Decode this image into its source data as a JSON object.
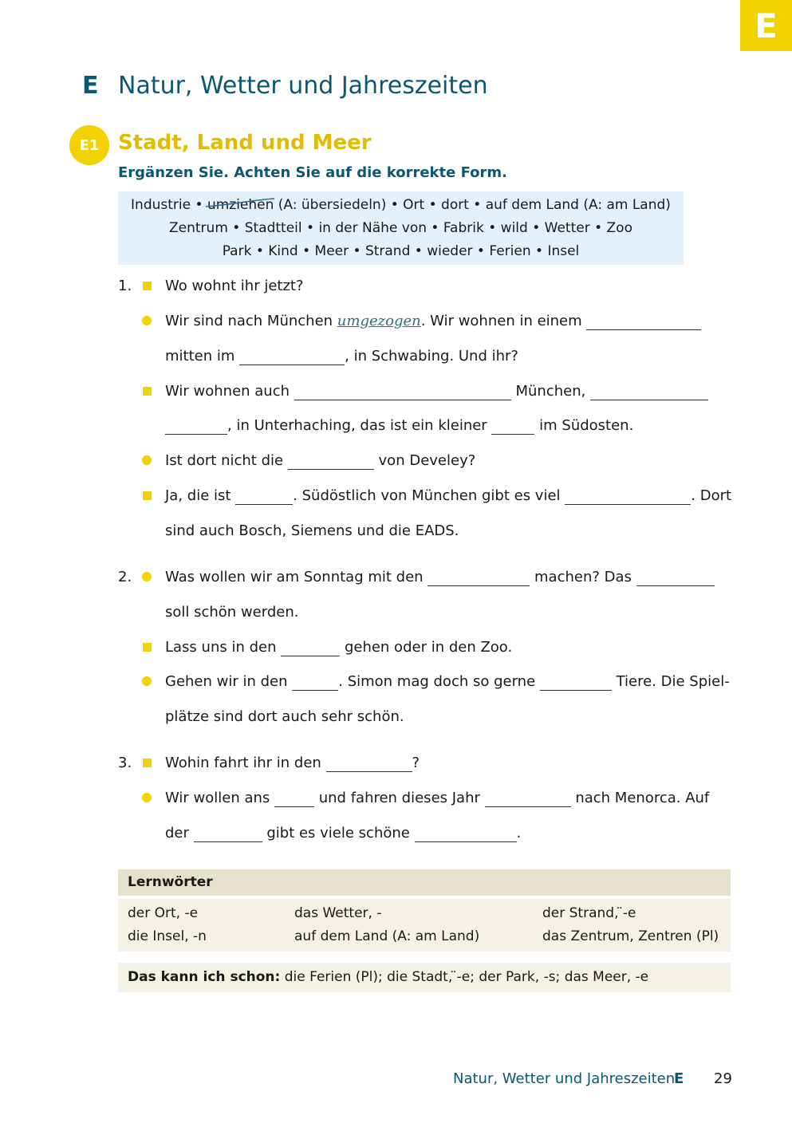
{
  "tab_letter": "E",
  "chapter": {
    "letter": "E",
    "title": "Natur, Wetter und Jahreszeiten"
  },
  "exercise": {
    "badge": "E1",
    "title": "Stadt, Land und Meer",
    "instruction": "Ergänzen Sie. Achten Sie auf die korrekte Form."
  },
  "wordbox": {
    "line1_before": "Industrie • ",
    "line1_struck": "umziehen",
    "line1_after": " (A: übersiedeln) • Ort • dort • auf dem Land (A: am Land)",
    "line2": "Zentrum • Stadtteil • in der Nähe von • Fabrik • wild • Wetter • Zoo",
    "line3": "Park • Kind • Meer • Strand • wieder • Ferien • Insel"
  },
  "dialogue": {
    "n1": "1.",
    "n2": "2.",
    "n3": "3.",
    "l01": "Wo wohnt ihr jetzt?",
    "l02a": "Wir sind nach München ",
    "l02_answer": "umgezogen",
    "l02b": ". Wir wohnen in einem ",
    "l03a": "mitten im ",
    "l03b": ", in Schwabing. Und ihr?",
    "l04a": "Wir wohnen auch ",
    "l04b": " München, ",
    "l05a": ", in Unterhaching, das ist ein kleiner ",
    "l05b": " im Südosten.",
    "l06a": "Ist dort nicht die ",
    "l06b": " von Develey?",
    "l07a": "Ja, die ist ",
    "l07b": ". Südöstlich von München gibt es viel ",
    "l07c": ". Dort",
    "l08": "sind auch Bosch, Siemens und die EADS.",
    "l09a": "Was wollen wir am Sonntag mit den ",
    "l09b": " machen? Das ",
    "l10": "soll schön werden.",
    "l11a": "Lass uns in den ",
    "l11b": " gehen oder in den Zoo.",
    "l12a": "Gehen wir in den ",
    "l12b": ". Simon mag doch so gerne ",
    "l12c": " Tiere. Die Spiel-",
    "l13": "plätze sind dort auch sehr schön.",
    "l14a": "Wohin fahrt ihr in den ",
    "l14b": "?",
    "l15a": "Wir wollen ans ",
    "l15b": " und fahren dieses Jahr ",
    "l15c": " nach Menorca. Auf",
    "l16a": "der ",
    "l16b": " gibt es viele schöne ",
    "l16c": "."
  },
  "lernwoerter": {
    "heading": "Lernwörter",
    "rows": [
      [
        "der Ort, -e",
        "das Wetter, -",
        "der Strand, ̈-e"
      ],
      [
        "die Insel, -n",
        "auf dem Land (A: am Land)",
        "das Zentrum, Zentren (Pl)"
      ]
    ]
  },
  "kann": {
    "label": "Das kann ich schon:",
    "text": " die Ferien (Pl); die Stadt, ̈-e; der Park, -s; das Meer, -e"
  },
  "footer": {
    "title": "Natur, Wetter und Jahreszeiten",
    "letter": "E",
    "page": "29"
  },
  "colors": {
    "accent_yellow": "#f2d200",
    "heading_blue": "#0b5873",
    "wordbox_bg": "#e4f1fb",
    "lern_bg": "#f4f2e6"
  }
}
